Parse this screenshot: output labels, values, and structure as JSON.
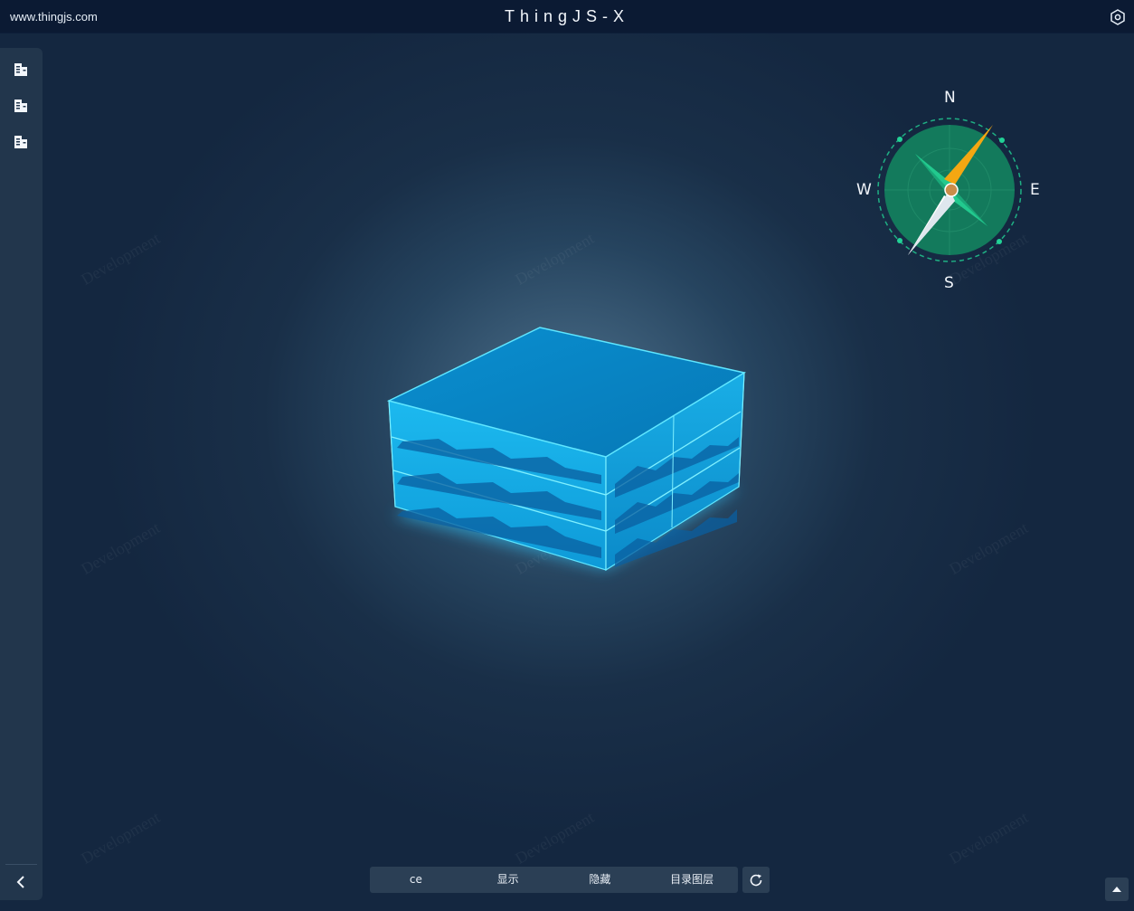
{
  "header": {
    "site_url": "www.thingjs.com",
    "title": "ThingJS-X"
  },
  "sidebar": {
    "items": [
      {
        "icon": "building-icon"
      },
      {
        "icon": "building-icon"
      },
      {
        "icon": "building-icon"
      }
    ],
    "collapse_icon": "chevron-left-icon"
  },
  "compass": {
    "north": "N",
    "east": "E",
    "south": "S",
    "west": "W",
    "colors": {
      "face": "#137a5c",
      "ring": "#1fb084",
      "needle_north": "#f4a712",
      "needle_south": "#ffffff",
      "accent": "#22d196"
    }
  },
  "watermark_text": "Development",
  "toolbar": {
    "buttons": [
      "ce",
      "显示",
      "隐藏",
      "目录图层"
    ],
    "refresh_icon": "refresh-icon"
  },
  "scroll_icon": "arrow-up-icon",
  "colors": {
    "header_bg": "#0b1a33",
    "cube_fill": "#0a8ccc",
    "cube_edge": "#5fe6ff"
  }
}
